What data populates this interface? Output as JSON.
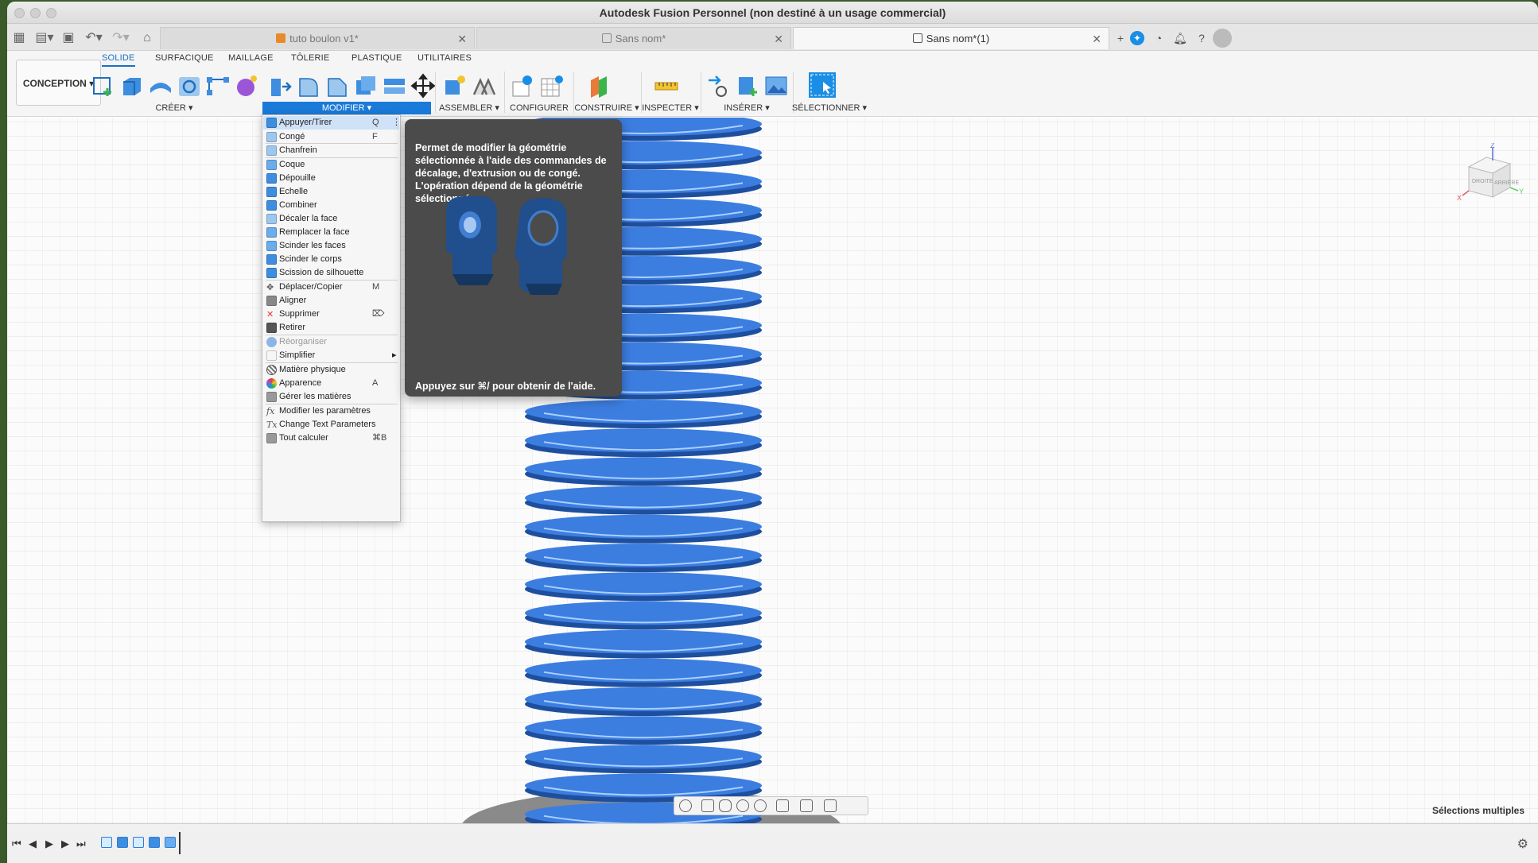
{
  "window": {
    "title": "Autodesk Fusion Personnel (non destiné à un usage commercial)"
  },
  "tabs": [
    {
      "label": "tuto boulon v1*",
      "active": false
    },
    {
      "label": "Sans nom*",
      "active": false
    },
    {
      "label": "Sans nom*(1)",
      "active": true
    }
  ],
  "workspace": {
    "label": "CONCEPTION ▾"
  },
  "ribbon_tabs": [
    "SOLIDE",
    "SURFACIQUE",
    "MAILLAGE",
    "TÔLERIE",
    "PLASTIQUE",
    "UTILITAIRES"
  ],
  "groups": {
    "creer": "CRÉER ▾",
    "modifier": "MODIFIER ▾",
    "assembler": "ASSEMBLER ▾",
    "configurer": "CONFIGURER ▾",
    "construire": "CONSTRUIRE ▾",
    "inspecter": "INSPECTER ▾",
    "inserer": "INSÉRER ▾",
    "selectionner": "SÉLECTIONNER ▾"
  },
  "menu": {
    "items": [
      {
        "label": "Appuyer/Tirer",
        "shortcut": "Q",
        "icon": "press-pull-icon"
      },
      {
        "label": "Congé",
        "shortcut": "F",
        "icon": "fillet-icon"
      },
      {
        "label": "Chanfrein",
        "shortcut": "",
        "icon": "chamfer-icon"
      },
      {
        "label": "Coque",
        "shortcut": "",
        "icon": "shell-icon"
      },
      {
        "label": "Dépouille",
        "shortcut": "",
        "icon": "draft-icon"
      },
      {
        "label": "Echelle",
        "shortcut": "",
        "icon": "scale-icon"
      },
      {
        "label": "Combiner",
        "shortcut": "",
        "icon": "combine-icon"
      },
      {
        "label": "Décaler la face",
        "shortcut": "",
        "icon": "offset-face-icon"
      },
      {
        "label": "Remplacer la face",
        "shortcut": "",
        "icon": "replace-face-icon"
      },
      {
        "label": "Scinder les faces",
        "shortcut": "",
        "icon": "split-face-icon"
      },
      {
        "label": "Scinder le corps",
        "shortcut": "",
        "icon": "split-body-icon"
      },
      {
        "label": "Scission de silhouette",
        "shortcut": "",
        "icon": "silhouette-split-icon"
      },
      {
        "label": "Déplacer/Copier",
        "shortcut": "M",
        "icon": "move-icon"
      },
      {
        "label": "Aligner",
        "shortcut": "",
        "icon": "align-icon"
      },
      {
        "label": "Supprimer",
        "shortcut": "⌦",
        "icon": "delete-icon"
      },
      {
        "label": "Retirer",
        "shortcut": "",
        "icon": "remove-icon"
      },
      {
        "label": "Réorganiser",
        "shortcut": "",
        "icon": "rearrange-icon"
      },
      {
        "label": "Simplifier",
        "shortcut": "",
        "icon": "simplify-icon"
      },
      {
        "label": "Matière physique",
        "shortcut": "",
        "icon": "physical-material-icon"
      },
      {
        "label": "Apparence",
        "shortcut": "A",
        "icon": "appearance-icon"
      },
      {
        "label": "Gérer les matières",
        "shortcut": "",
        "icon": "manage-materials-icon"
      },
      {
        "label": "Modifier les paramètres",
        "shortcut": "",
        "icon": "fx-icon"
      },
      {
        "label": "Change Text Parameters",
        "shortcut": "",
        "icon": "tx-icon"
      },
      {
        "label": "Tout calculer",
        "shortcut": "⌘B",
        "icon": "compute-icon"
      }
    ]
  },
  "tooltip": {
    "text": "Permet de modifier la géométrie sélectionnée à l'aide des commandes de décalage, d'extrusion ou de congé. L'opération dépend de la géométrie sélectionnée.",
    "footer": "Appuyez sur ⌘/ pour obtenir de l'aide."
  },
  "viewcube": {
    "face_right": "DROITE",
    "face_back": "ARRIÈRE",
    "x": "X",
    "y": "Y",
    "z": "Z"
  },
  "status": {
    "selection": "Sélections multiples"
  },
  "colors": {
    "accent": "#1a7ad9",
    "body": "#2d63b8",
    "tooltip_bg": "#4b4b4b"
  }
}
